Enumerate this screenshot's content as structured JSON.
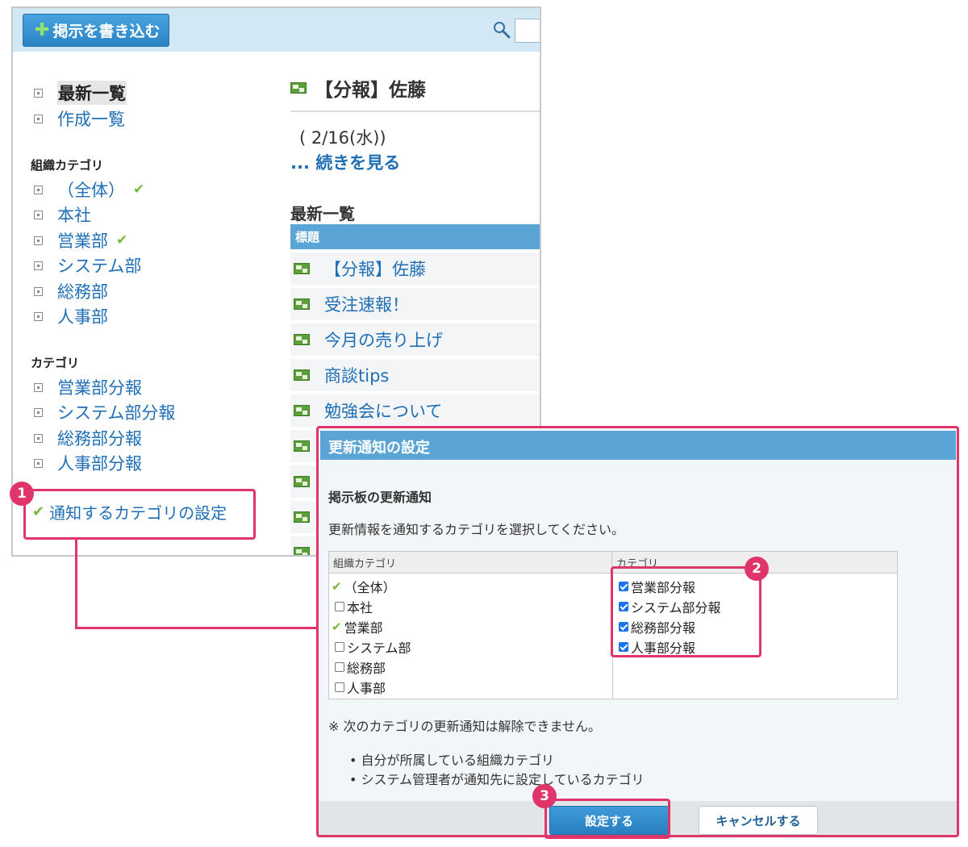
{
  "toolbar": {
    "post_button_label": "掲示を書き込む",
    "post_button_icon": "plus-icon",
    "search_icon": "search-icon"
  },
  "sidebar": {
    "top_items": [
      {
        "label": "最新一覧",
        "current": true
      },
      {
        "label": "作成一覧"
      }
    ],
    "org_heading": "組織カテゴリ",
    "org_items": [
      {
        "label": "（全体）",
        "notified": true
      },
      {
        "label": "本社"
      },
      {
        "label": "営業部",
        "notified": true
      },
      {
        "label": "システム部"
      },
      {
        "label": "総務部"
      },
      {
        "label": "人事部"
      }
    ],
    "cat_heading": "カテゴリ",
    "cat_items": [
      {
        "label": "営業部分報"
      },
      {
        "label": "システム部分報"
      },
      {
        "label": "総務部分報"
      },
      {
        "label": "人事部分報"
      }
    ],
    "notify_link": "通知するカテゴリの設定"
  },
  "article": {
    "title": "【分報】佐藤",
    "date": "( 2/16(水))",
    "read_more": "... 続きを見る"
  },
  "latest_list": {
    "title": "最新一覧",
    "column_header": "標題",
    "rows": [
      "【分報】佐藤",
      "受注速報！",
      "今月の売り上げ",
      "商談tips",
      "勉強会について"
    ]
  },
  "dialog": {
    "title": "更新通知の設定",
    "section": "掲示板の更新通知",
    "instruction": "更新情報を通知するカテゴリを選択してください。",
    "col1_header": "組織カテゴリ",
    "col2_header": "カテゴリ",
    "org_options": [
      {
        "label": "（全体）",
        "state": "locked"
      },
      {
        "label": "本社",
        "state": "unchecked"
      },
      {
        "label": "営業部",
        "state": "locked"
      },
      {
        "label": "システム部",
        "state": "unchecked"
      },
      {
        "label": "総務部",
        "state": "unchecked"
      },
      {
        "label": "人事部",
        "state": "unchecked"
      }
    ],
    "cat_options": [
      {
        "label": "営業部分報",
        "checked": true
      },
      {
        "label": "システム部分報",
        "checked": true
      },
      {
        "label": "総務部分報",
        "checked": true
      },
      {
        "label": "人事部分報",
        "checked": true
      }
    ],
    "note": "※ 次のカテゴリの更新通知は解除できません。",
    "bullets": [
      "自分が所属している組織カテゴリ",
      "システム管理者が通知先に設定しているカテゴリ"
    ],
    "ok_label": "設定する",
    "cancel_label": "キャンセルする"
  },
  "callouts": {
    "badge_1": "1",
    "badge_2": "2",
    "badge_3": "3"
  },
  "colors": {
    "accent": "#e0356a",
    "header_blue": "#5aa5d6",
    "link": "#1f6fb6",
    "check_green": "#7ab83a"
  }
}
